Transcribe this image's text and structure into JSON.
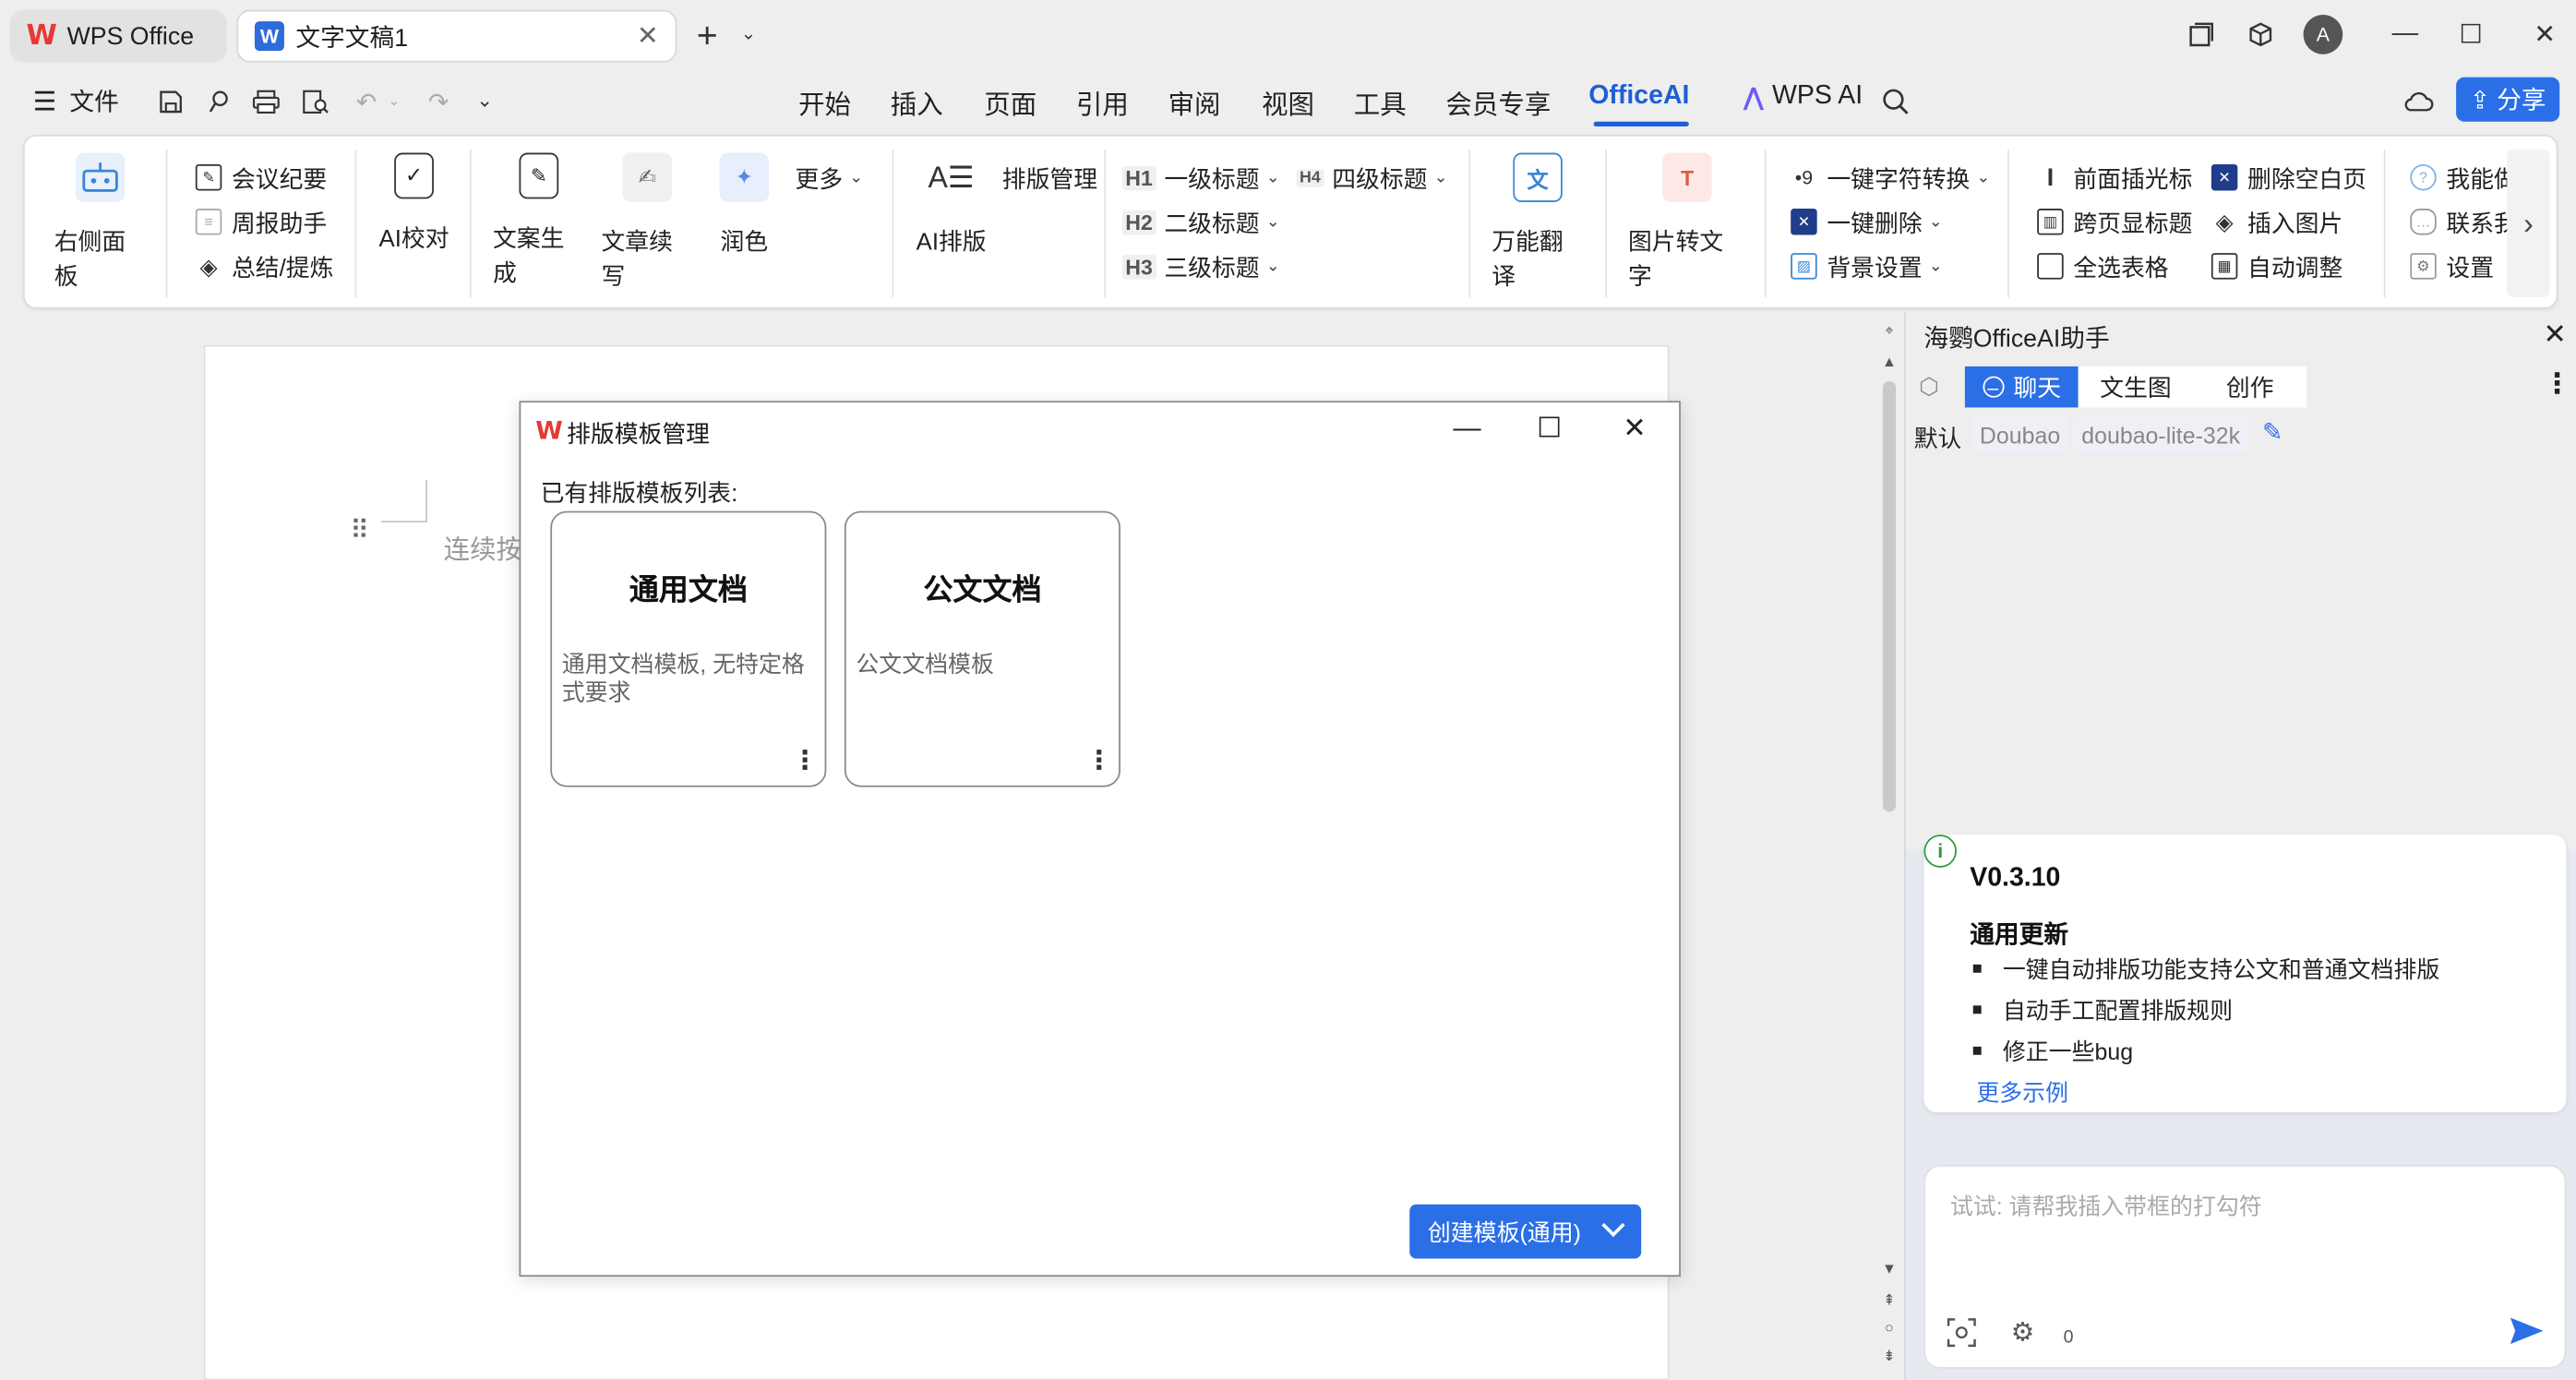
{
  "tabs": {
    "wps": "WPS Office",
    "doc": "文字文稿1",
    "doc_icon": "W"
  },
  "menu": {
    "file": "文件",
    "items": [
      "开始",
      "插入",
      "页面",
      "引用",
      "审阅",
      "视图",
      "工具",
      "会员专享",
      "OfficeAI",
      "WPS AI"
    ],
    "active": "OfficeAI",
    "share": "分享"
  },
  "ribbon": {
    "right_panel": "右侧面板",
    "meeting": "会议纪要",
    "weekly": "周报助手",
    "summary": "总结/提炼",
    "ai_proof": "AI校对",
    "copy_gen": "文案生成",
    "continue": "文章续写",
    "polish": "润色",
    "more": "更多",
    "ai_layout": "AI排版",
    "layout_mgmt": "排版管理",
    "h1": "一级标题",
    "h2": "二级标题",
    "h3": "三级标题",
    "h4": "四级标题",
    "translate": "万能翻译",
    "img2text": "图片转文字",
    "char_convert": "一键字符转换",
    "one_delete": "一键删除",
    "bg_setting": "背景设置",
    "cursor_front": "前面插光标",
    "cross_title": "跨页显标题",
    "select_table": "全选表格",
    "del_blank": "删除空白页",
    "insert_img": "插入图片",
    "auto_adjust": "自动调整",
    "can_do": "我能做",
    "contact": "联系我",
    "settings": "设置"
  },
  "document": {
    "placeholder": "连续按"
  },
  "dialog": {
    "title": "排版模板管理",
    "list_label": "已有排版模板列表:",
    "templates": [
      {
        "name": "通用文档",
        "desc": "通用文档模板, 无特定格式要求"
      },
      {
        "name": "公文文档",
        "desc": "公文文档模板"
      }
    ],
    "create_button": "创建模板(通用)"
  },
  "panel": {
    "title": "海鹦OfficeAI助手",
    "tabs": [
      "聊天",
      "文生图",
      "创作"
    ],
    "active_tab": "聊天",
    "default_label": "默认",
    "provider": "Doubao",
    "model": "doubao-lite-32k",
    "version": "V0.3.10",
    "update_title": "通用更新",
    "updates": [
      "一键自动排版功能支持公文和普通文档排版",
      "自动手工配置排版规则",
      "修正一些bug"
    ],
    "more_examples": "更多示例",
    "input_placeholder": "试试: 请帮我插入带框的打勾符",
    "char_count": "0"
  },
  "colors": {
    "accent": "#2b6fe7",
    "wps_red": "#e53935"
  }
}
